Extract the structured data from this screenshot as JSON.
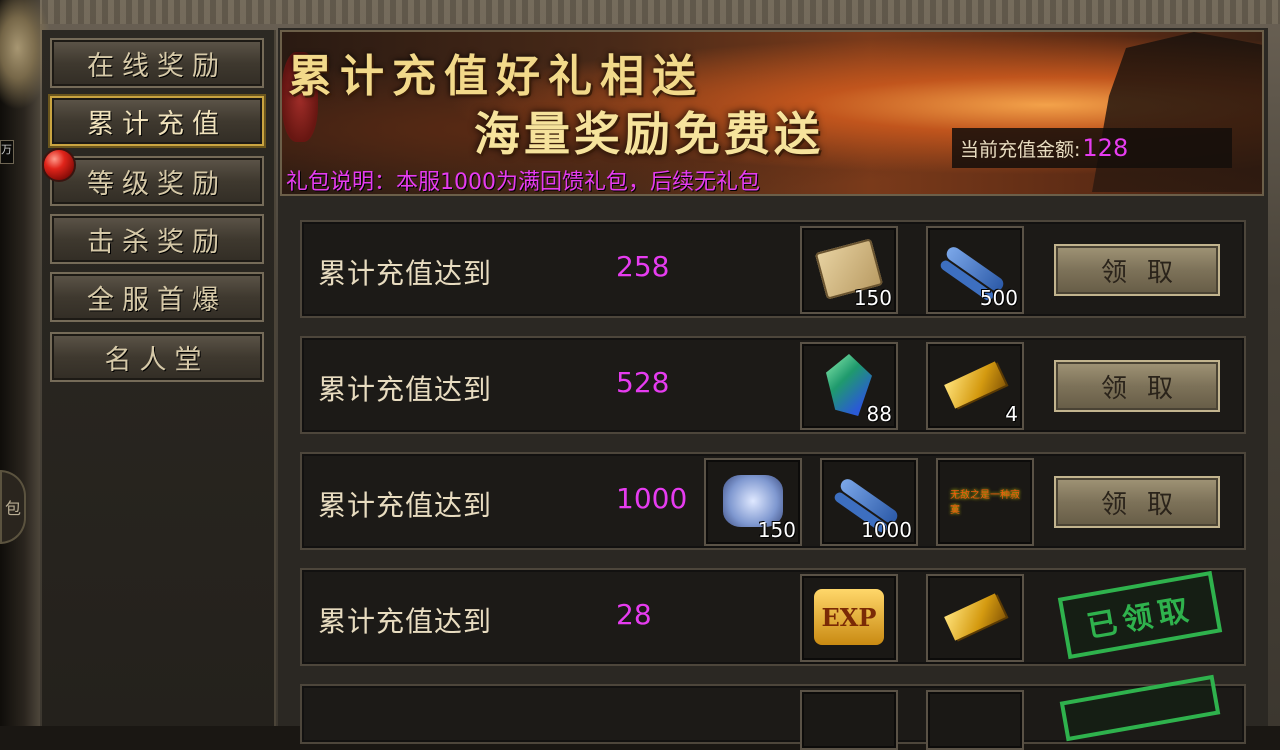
{
  "sidebar": {
    "items": [
      {
        "label": "在线奖励",
        "active": false
      },
      {
        "label": "累计充值",
        "active": true
      },
      {
        "label": "等级奖励",
        "active": false
      },
      {
        "label": "击杀奖励",
        "active": false
      },
      {
        "label": "全服首爆",
        "active": false
      },
      {
        "label": "名人堂",
        "active": false
      }
    ]
  },
  "left_edge": {
    "badge_text": "包",
    "chip_text": "万"
  },
  "banner": {
    "title1": "累计充值好礼相送",
    "title2": "海量奖励免费送",
    "description": "礼包说明：本服1000为满回馈礼包，后续无礼包",
    "recharge_label": "当前充值金额:",
    "recharge_value": "128"
  },
  "rows": [
    {
      "label": "累计充值达到",
      "amount": "258",
      "items": [
        {
          "icon": "scroll-icon",
          "count": "150"
        },
        {
          "icon": "blue-scroll-icon",
          "count": "500"
        }
      ],
      "action": "领取",
      "claimed": false
    },
    {
      "label": "累计充值达到",
      "amount": "528",
      "items": [
        {
          "icon": "gem-icon",
          "count": "88"
        },
        {
          "icon": "gold-bar-icon",
          "count": "4"
        }
      ],
      "action": "领取",
      "claimed": false
    },
    {
      "label": "累计充值达到",
      "amount": "1000",
      "items": [
        {
          "icon": "puzzle-piece-icon",
          "count": "150"
        },
        {
          "icon": "blue-scroll-icon",
          "count": "1000"
        },
        {
          "icon": "title-icon",
          "count": "",
          "text": "无敌之是一种寂寞"
        }
      ],
      "action": "领取",
      "claimed": false
    },
    {
      "label": "累计充值达到",
      "amount": "28",
      "items": [
        {
          "icon": "exp-icon",
          "count": "",
          "text": "EXP"
        },
        {
          "icon": "gold-bar-icon",
          "count": ""
        }
      ],
      "action": "已领取",
      "claimed": true
    }
  ],
  "colors": {
    "accent": "#e63cf0",
    "stamp": "#2fb24d",
    "active_border": "#c9a441"
  }
}
